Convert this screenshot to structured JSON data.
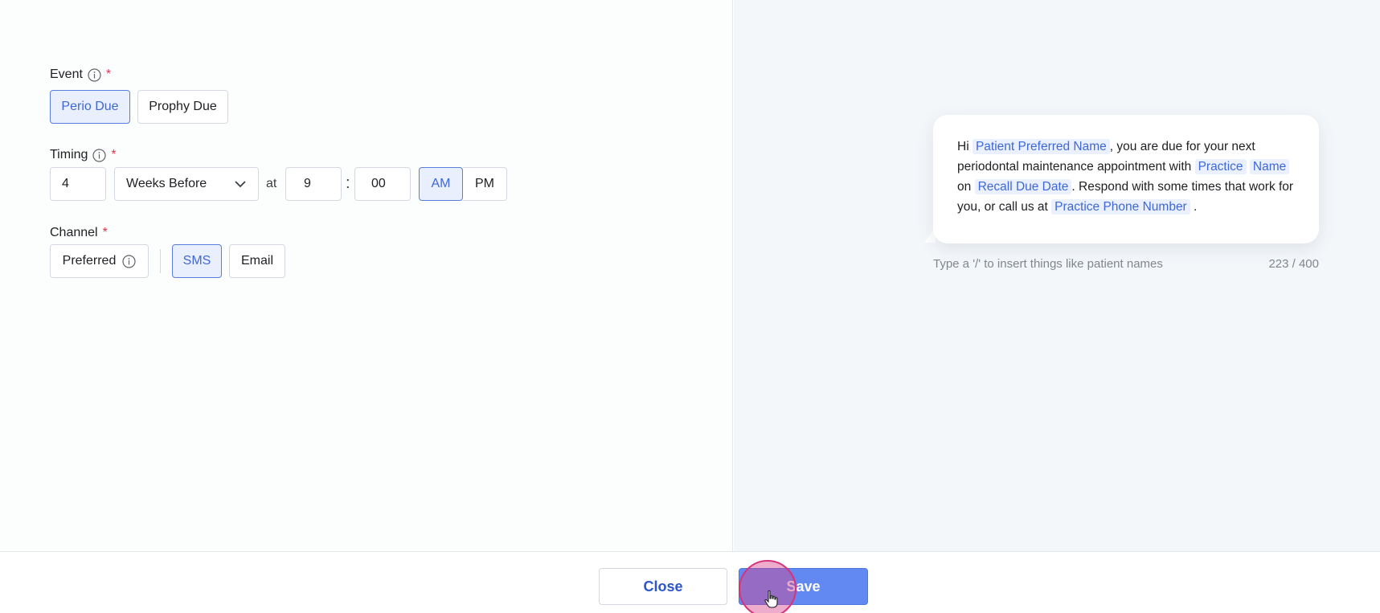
{
  "form": {
    "event": {
      "label": "Event",
      "required_mark": "*",
      "options": [
        "Perio Due",
        "Prophy Due"
      ],
      "selected": "Perio Due"
    },
    "timing": {
      "label": "Timing",
      "required_mark": "*",
      "amount": "4",
      "relation": "Weeks Before",
      "at_label": "at",
      "hour": "9",
      "colon": ":",
      "minute": "00",
      "meridiem_options": [
        "AM",
        "PM"
      ],
      "meridiem_selected": "AM"
    },
    "channel": {
      "label": "Channel",
      "required_mark": "*",
      "preferred_label": "Preferred",
      "options": [
        "SMS",
        "Email"
      ],
      "selected": "SMS"
    }
  },
  "preview": {
    "message": {
      "t1": "Hi",
      "token_patient": "Patient Preferred Name",
      "t2": ", you are due for your next periodontal maintenance appointment with",
      "token_practice_a": "Practice",
      "token_practice_b": "Name",
      "t3": "on",
      "token_recall": "Recall Due Date",
      "t4": ". Respond with some times that work for you, or call us at",
      "token_phone": "Practice Phone Number",
      "t5": "."
    },
    "hint": "Type a '/' to insert things like patient names",
    "counter": "223 / 400"
  },
  "footer": {
    "close_label": "Close",
    "save_label": "Save"
  },
  "colors": {
    "accent": "#5a7dde",
    "accent_bg": "#e9effd",
    "required": "#e0354a",
    "save_button": "#6189f1"
  },
  "icons": {
    "info": "info-circle-icon",
    "dropdown": "chevron-down-icon",
    "cursor": "hand-pointer-icon"
  }
}
